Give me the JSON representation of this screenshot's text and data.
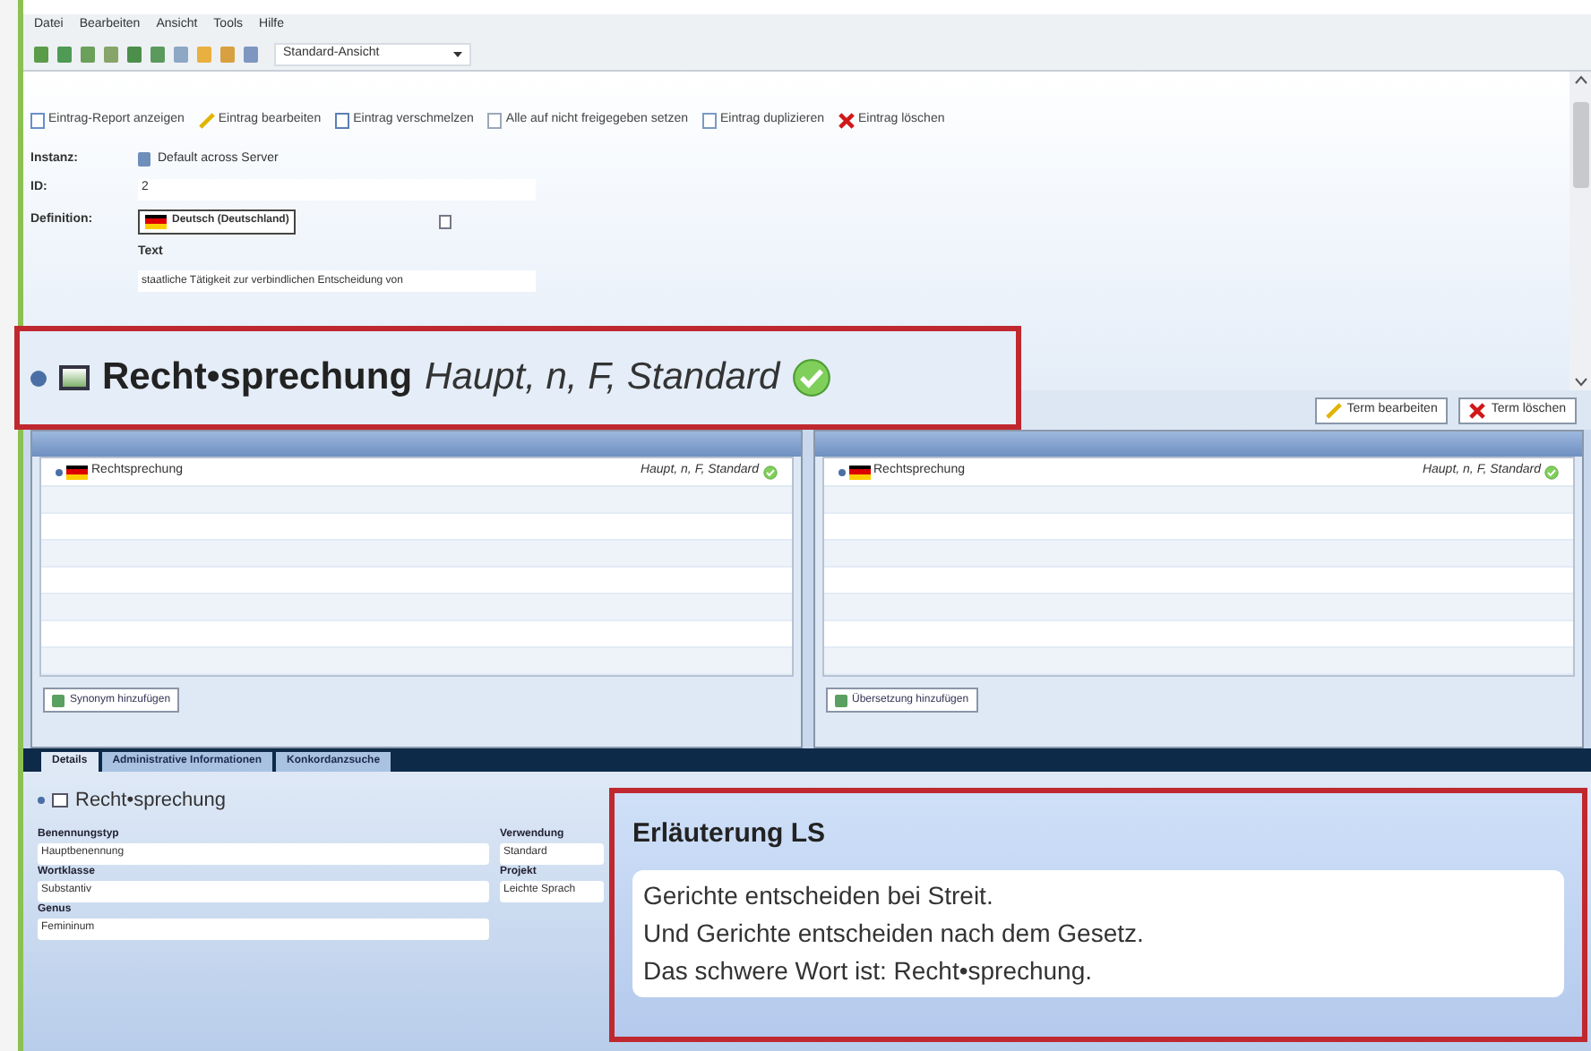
{
  "menu": [
    "Datei",
    "Bearbeiten",
    "Ansicht",
    "Tools",
    "Hilfe"
  ],
  "toolbar": {
    "view_select": "Standard-Ansicht"
  },
  "actions": [
    {
      "label": "Eintrag-Report anzeigen",
      "kind": "report"
    },
    {
      "label": "Eintrag bearbeiten",
      "kind": "edit"
    },
    {
      "label": "Eintrag verschmelzen",
      "kind": "merge"
    },
    {
      "label": "Alle auf nicht freigegeben setzen",
      "kind": "release"
    },
    {
      "label": "Eintrag duplizieren",
      "kind": "duplicate"
    },
    {
      "label": "Eintrag löschen",
      "kind": "delete"
    }
  ],
  "form": {
    "instance_label": "Instanz:",
    "instance": "Default across Server",
    "id_label": "ID:",
    "id": "2",
    "definition_label": "Definition:",
    "language": "Deutsch (Deutschland)",
    "text_label": "Text",
    "text": "staatliche Tätigkeit zur verbindlichen Entscheidung von"
  },
  "term_callout": {
    "term": "Recht•sprechung",
    "attributes": "Haupt, n, F, Standard"
  },
  "term_buttons": [
    {
      "label": "Term bearbeiten",
      "kind": "edit"
    },
    {
      "label": "Term löschen",
      "kind": "delete"
    }
  ],
  "panels": [
    {
      "entries": [
        {
          "term": "Rechtsprechung",
          "attributes": "Haupt, n, F, Standard"
        }
      ],
      "add_button": "Synonym hinzufügen"
    },
    {
      "entries": [
        {
          "term": "Rechtsprechung",
          "attributes": "Haupt, n, F, Standard"
        }
      ],
      "add_button": "Übersetzung hinzufügen"
    }
  ],
  "tabs": [
    {
      "label": "Details",
      "selected": true
    },
    {
      "label": "Administrative Informationen",
      "selected": false
    },
    {
      "label": "Konkordanzsuche",
      "selected": false
    }
  ],
  "details": {
    "heading": "Recht•sprechung",
    "left_fields": [
      {
        "label": "Benennungstyp",
        "value": "Hauptbenennung"
      },
      {
        "label": "Wortklasse",
        "value": "Substantiv"
      },
      {
        "label": "Genus",
        "value": "Femininum"
      }
    ],
    "right_fields": [
      {
        "label": "Verwendung",
        "value": "Standard"
      },
      {
        "label": "Projekt",
        "value": "Leichte Sprach"
      }
    ]
  },
  "explanation": {
    "title": "Erläuterung LS",
    "lines": [
      "Gerichte entscheiden bei Streit.",
      "Und Gerichte entscheiden nach dem Gesetz.",
      "Das schwere Wort ist: Recht•sprechung."
    ]
  }
}
